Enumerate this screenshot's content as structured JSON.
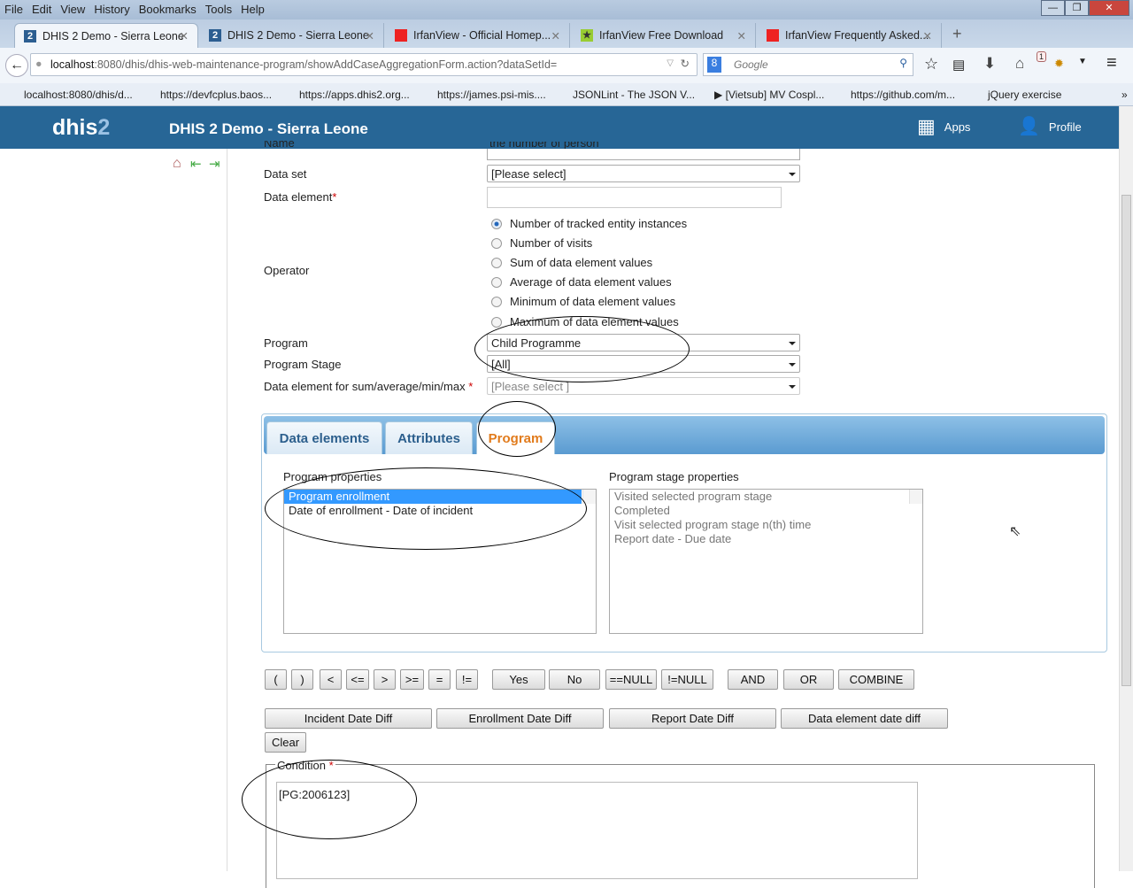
{
  "browser": {
    "menu": [
      "File",
      "Edit",
      "View",
      "History",
      "Bookmarks",
      "Tools",
      "Help"
    ],
    "tabs": [
      {
        "title": "DHIS 2 Demo - Sierra Leone",
        "active": true
      },
      {
        "title": "DHIS 2 Demo - Sierra Leone"
      },
      {
        "title": "IrfanView - Official Homep..."
      },
      {
        "title": "IrfanView Free Download"
      },
      {
        "title": "IrfanView Frequently Asked..."
      }
    ],
    "url_host": "localhost",
    "url_rest": ":8080/dhis/dhis-web-maintenance-program/showAddCaseAggregationForm.action?dataSetId=",
    "search_placeholder": "Google",
    "notification_count": "1",
    "bookmarks": [
      "localhost:8080/dhis/d...",
      "https://devfcplus.baos...",
      "https://apps.dhis2.org...",
      "https://james.psi-mis....",
      "JSONLint - The JSON V...",
      "▶ [Vietsub] MV Cospl...",
      "https://github.com/m...",
      "jQuery exercise"
    ]
  },
  "header": {
    "logo": "dhis",
    "logo_num": "2",
    "title": "DHIS 2 Demo - Sierra Leone",
    "apps": "Apps",
    "profile": "Profile"
  },
  "form": {
    "name_label": "Name",
    "name_value": "the number of person",
    "dataset_label": "Data set",
    "dataset_value": "[Please select]",
    "data_element_label": "Data element",
    "required": "*",
    "operator_label": "Operator",
    "operators": [
      "Number of tracked entity instances",
      "Number of visits",
      "Sum of data element values",
      "Average of data element values",
      "Minimum of data element values",
      "Maximum of data element values"
    ],
    "program_label": "Program",
    "program_value": "Child Programme",
    "stage_label": "Program Stage",
    "stage_value": "[All]",
    "de_sum_label": "Data element for sum/average/min/max",
    "de_sum_value": "[Please select ]"
  },
  "tabs": [
    "Data elements",
    "Attributes",
    "Program"
  ],
  "program_props": {
    "title": "Program properties",
    "items": [
      "Program enrollment",
      "Date of enrollment - Date of incident"
    ]
  },
  "stage_props": {
    "title": "Program stage properties",
    "items": [
      "Visited selected program stage",
      "Completed",
      "Visit selected program stage n(th) time",
      "Report date - Due date"
    ]
  },
  "operator_buttons": [
    "(",
    ")",
    "<",
    "<=",
    ">",
    ">=",
    "=",
    "!=",
    "Yes",
    "No",
    "==NULL",
    "!=NULL",
    "AND",
    "OR",
    "COMBINE"
  ],
  "date_buttons": [
    "Incident Date Diff",
    "Enrollment Date Diff",
    "Report Date Diff",
    "Data element date diff"
  ],
  "clear": "Clear",
  "condition": {
    "label": "Condition",
    "value": "[PG:2006123]"
  }
}
